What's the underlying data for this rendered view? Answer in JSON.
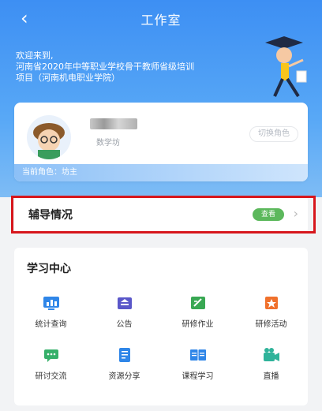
{
  "nav": {
    "back_icon": "back-arrow-icon",
    "title": "工作室"
  },
  "welcome": {
    "line1": "欢迎来到,",
    "line2": "河南省2020年中等职业学校骨干教师省级培训",
    "line3": "项目（河南机电职业学院）"
  },
  "user": {
    "role_label": "数学坊",
    "switch_label": "切换角色",
    "current_role": "当前角色：坊主"
  },
  "tutor": {
    "title": "辅导情况",
    "view_label": "查看"
  },
  "study_center": {
    "title": "学习中心",
    "items": [
      {
        "label": "统计查询",
        "icon": "statistics-icon",
        "color": "#2f86e8"
      },
      {
        "label": "公告",
        "icon": "announcement-icon",
        "color": "#5a57c9"
      },
      {
        "label": "研修作业",
        "icon": "homework-icon",
        "color": "#39a853"
      },
      {
        "label": "研修活动",
        "icon": "activity-icon",
        "color": "#f0712c"
      },
      {
        "label": "研讨交流",
        "icon": "discussion-icon",
        "color": "#36b06a"
      },
      {
        "label": "资源分享",
        "icon": "resource-share-icon",
        "color": "#2f86e8"
      },
      {
        "label": "课程学习",
        "icon": "course-book-icon",
        "color": "#2f86e8"
      },
      {
        "label": "直播",
        "icon": "live-camera-icon",
        "color": "#2fb39a"
      }
    ]
  },
  "colors": {
    "primary": "#3d8ff3",
    "highlight_border": "#d7161c",
    "view_btn": "#5cb85c"
  }
}
